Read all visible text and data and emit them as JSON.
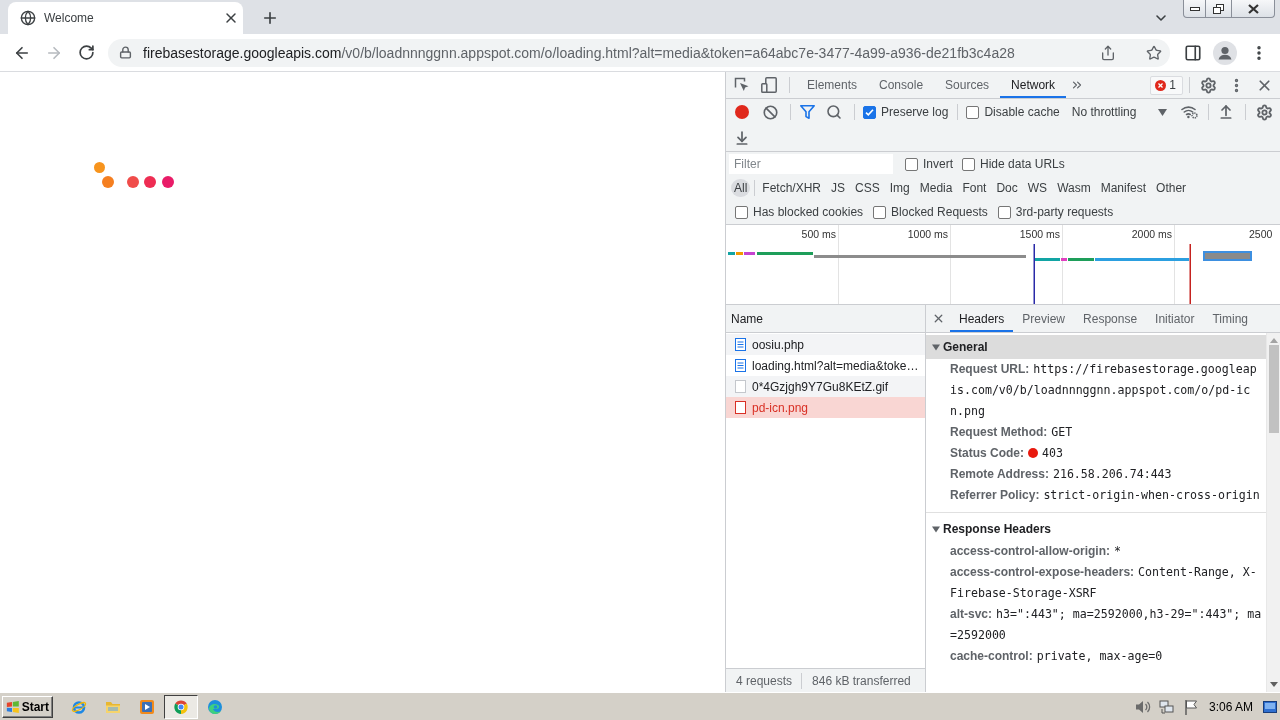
{
  "browser": {
    "tabs": [
      {
        "title": "Welcome",
        "selected": true
      }
    ],
    "address": {
      "host": "firebasestorage.googleapis.com",
      "path": "/v0/b/loadnnnggnn.appspot.com/o/loading.html?alt=media&token=a64abc7e-3477-4a99-a936-de21fb3c4a28"
    }
  },
  "devtools": {
    "tabs": [
      {
        "label": "Elements",
        "selected": false
      },
      {
        "label": "Console",
        "selected": false
      },
      {
        "label": "Sources",
        "selected": false
      },
      {
        "label": "Network",
        "selected": true
      }
    ],
    "error_count": "1",
    "recording": true,
    "filter_open": true,
    "preserve_log": {
      "label": "Preserve log",
      "checked": true
    },
    "disable_cache": {
      "label": "Disable cache",
      "checked": false
    },
    "throttling": "No throttling",
    "filter": {
      "placeholder": "Filter",
      "options": [
        {
          "label": "Invert",
          "checked": false
        },
        {
          "label": "Hide data URLs",
          "checked": false
        }
      ]
    },
    "types": [
      {
        "label": "All",
        "selected": true
      },
      {
        "label": "Fetch/XHR",
        "selected": false
      },
      {
        "label": "JS",
        "selected": false
      },
      {
        "label": "CSS",
        "selected": false
      },
      {
        "label": "Img",
        "selected": false
      },
      {
        "label": "Media",
        "selected": false
      },
      {
        "label": "Font",
        "selected": false
      },
      {
        "label": "Doc",
        "selected": false
      },
      {
        "label": "WS",
        "selected": false
      },
      {
        "label": "Wasm",
        "selected": false
      },
      {
        "label": "Manifest",
        "selected": false
      },
      {
        "label": "Other",
        "selected": false
      }
    ],
    "blocking_options": [
      {
        "label": "Has blocked cookies",
        "checked": false
      },
      {
        "label": "Blocked Requests",
        "checked": false
      },
      {
        "label": "3rd-party requests",
        "checked": false
      }
    ],
    "overview": {
      "ticks": [
        "500 ms",
        "1000 ms",
        "1500 ms",
        "2000 ms",
        "2500"
      ]
    },
    "requests": {
      "column": "Name",
      "rows": [
        {
          "name": "oosiu.php",
          "kind": "document",
          "failed": false,
          "selected": false
        },
        {
          "name": "loading.html?alt=media&toke…",
          "kind": "document",
          "failed": false,
          "selected": false
        },
        {
          "name": "0*4Gzjgh9Y7Gu8KEtZ.gif",
          "kind": "image",
          "failed": false,
          "selected": false
        },
        {
          "name": "pd-icn.png",
          "kind": "image",
          "failed": true,
          "selected": true
        }
      ],
      "summary": [
        "4 requests",
        "846 kB transferred"
      ]
    },
    "details": {
      "tabs": [
        {
          "label": "Headers",
          "selected": true
        },
        {
          "label": "Preview",
          "selected": false
        },
        {
          "label": "Response",
          "selected": false
        },
        {
          "label": "Initiator",
          "selected": false
        },
        {
          "label": "Timing",
          "selected": false
        }
      ],
      "sections": [
        {
          "title": "General",
          "expanded": true,
          "selected": true,
          "rows": [
            {
              "name": "Request URL:",
              "value": "https://firebasestorage.googleapis.com/v0/b/loadnnnggnn.appspot.com/o/pd-icn.png",
              "kind": "text"
            },
            {
              "name": "Request Method:",
              "value": "GET",
              "kind": "text"
            },
            {
              "name": "Status Code:",
              "value": "403",
              "kind": "status"
            },
            {
              "name": "Remote Address:",
              "value": "216.58.206.74:443",
              "kind": "text"
            },
            {
              "name": "Referrer Policy:",
              "value": "strict-origin-when-cross-origin",
              "kind": "text"
            }
          ]
        },
        {
          "title": "Response Headers",
          "expanded": true,
          "selected": false,
          "rows": [
            {
              "name": "access-control-allow-origin:",
              "value": "*",
              "kind": "text"
            },
            {
              "name": "access-control-expose-headers:",
              "value": "Content-Range, X-Firebase-Storage-XSRF",
              "kind": "text"
            },
            {
              "name": "alt-svc:",
              "value": "h3=\":443\"; ma=2592000,h3-29=\":443\"; ma=2592000",
              "kind": "text"
            },
            {
              "name": "cache-control:",
              "value": "private, max-age=0",
              "kind": "text"
            }
          ]
        }
      ]
    }
  },
  "taskbar": {
    "start": "Start",
    "apps": [
      {
        "kind": "ring-logo",
        "selected": false
      },
      {
        "kind": "folder",
        "selected": false
      },
      {
        "kind": "player",
        "selected": false
      },
      {
        "kind": "browser",
        "selected": true
      },
      {
        "kind": "wave-logo",
        "selected": false
      }
    ],
    "clock": "3:06 AM"
  }
}
